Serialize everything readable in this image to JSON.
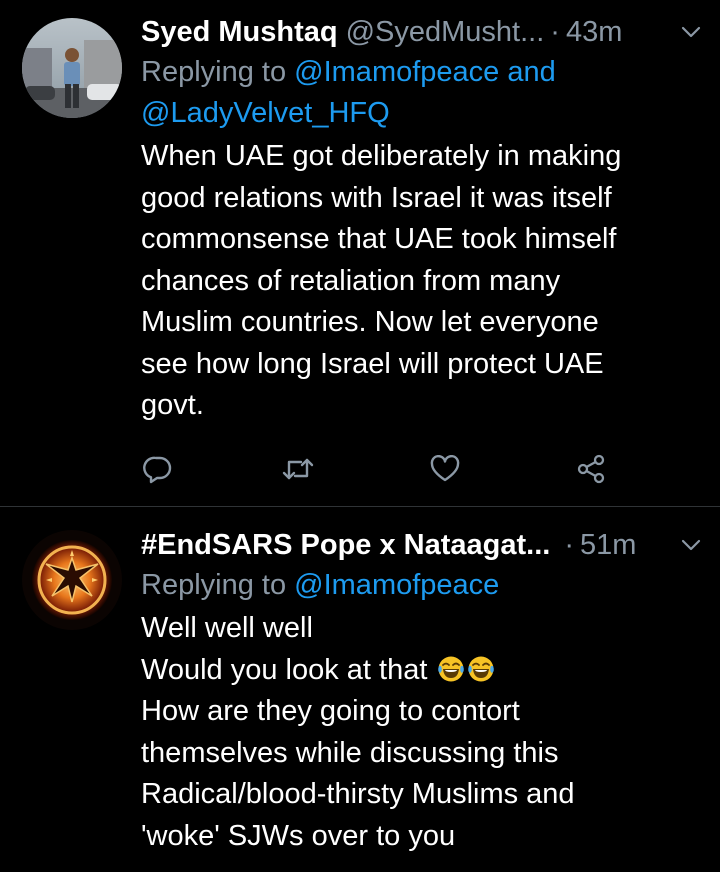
{
  "colors": {
    "background": "#000000",
    "text": "#ffffff",
    "secondary": "#8b98a5",
    "link": "#1d9bf0",
    "divider": "#2f3336"
  },
  "tweets": [
    {
      "display_name": "Syed Mushtaq",
      "handle": "@SyedMusht...",
      "separator": "·",
      "time": "43m",
      "reply_prefix": "Replying to",
      "mention_1": "@Imamofpeace",
      "reply_and": "and",
      "mention_2": "@LadyVelvet_HFQ",
      "body_lines": [
        "When UAE got deliberately in making",
        "good relations with Israel it was itself",
        "commonsense that UAE took himself",
        "chances of retaliation from many",
        "Muslim countries. Now  let everyone",
        "see how long Israel will protect UAE",
        "govt."
      ],
      "avatar_icon": "profile-photo-man-icon",
      "actions": [
        "reply-icon",
        "retweet-icon",
        "like-icon",
        "share-icon"
      ]
    },
    {
      "display_name": "#EndSARS Pope x Nataagat...",
      "separator": "·",
      "time": "51m",
      "reply_prefix": "Replying to",
      "mention_1": "@Imamofpeace",
      "body_lines": [
        "Well well well",
        "Would you look at that",
        "How are they going to contort",
        "themselves while discussing this",
        "Radical/blood-thirsty Muslims and",
        "'woke' SJWs over to you"
      ],
      "emoji": [
        "tears-of-joy-emoji-icon",
        "tears-of-joy-emoji-icon"
      ],
      "avatar_icon": "mockingjay-fire-icon"
    }
  ]
}
